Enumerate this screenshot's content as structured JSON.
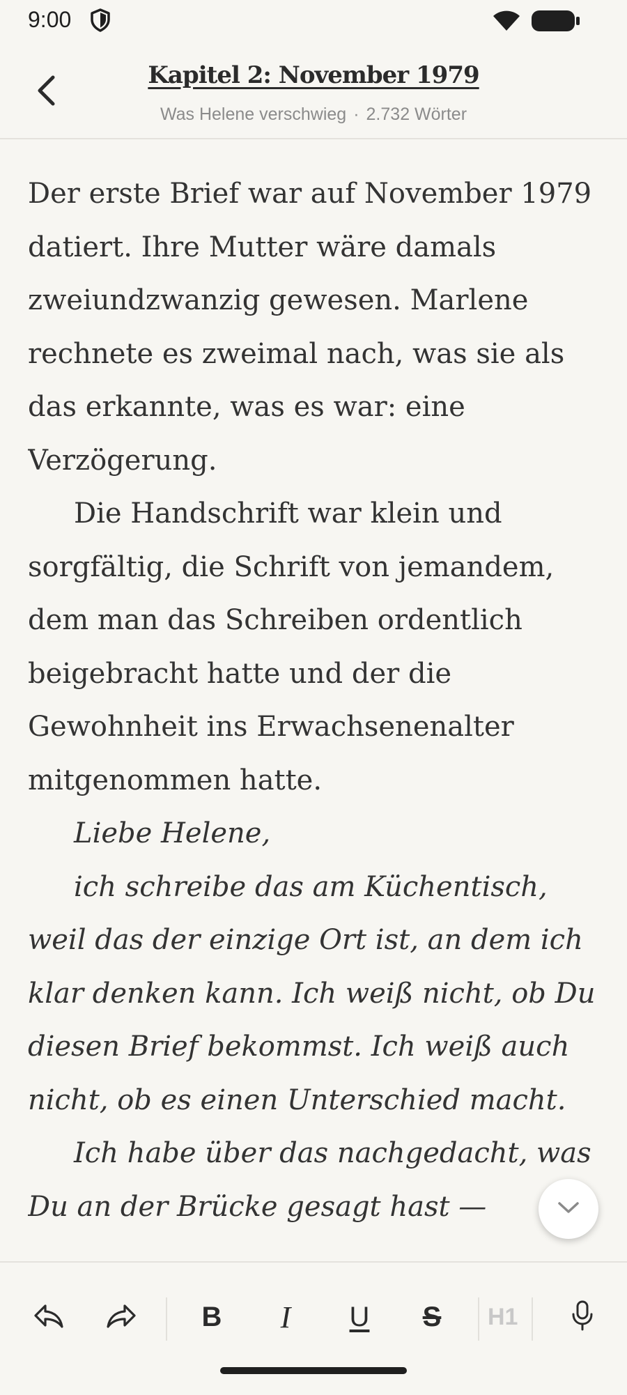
{
  "status_bar": {
    "time": "9:00",
    "icons": [
      "shield-icon",
      "wifi-icon",
      "battery-icon"
    ]
  },
  "header": {
    "chapter_title": "Kapitel 2: November 1979",
    "book_title": "Was Helene verschwieg",
    "separator": "·",
    "word_count": "2.732 Wörter"
  },
  "editor": {
    "paragraphs": [
      {
        "text": "Der erste Brief war auf November 1979 datiert. Ihre Mutter wäre damals zweiundzwanzig gewesen. Marlene rechnete es zweimal nach, was sie als das erkannte, was es war: eine Verzögerung.",
        "indent": false,
        "italic": false
      },
      {
        "text": "Die Handschrift war klein und sorgfältig, die Schrift von jemandem, dem man das Schreiben ordentlich beigebracht hatte und der die Gewohnheit ins Erwachsenenalter mitgenommen hatte.",
        "indent": true,
        "italic": false
      },
      {
        "text": "Liebe Helene,",
        "indent": true,
        "italic": true
      },
      {
        "text": "ich schreibe das am Küchentisch, weil das der einzige Ort ist, an dem ich klar denken kann. Ich weiß nicht, ob Du diesen Brief bekommst. Ich weiß auch nicht, ob es einen Unterschied macht.",
        "indent": true,
        "italic": true
      },
      {
        "text": "Ich habe über das nachgedacht, was Du an der Brücke gesagt hast —",
        "indent": true,
        "italic": true
      }
    ]
  },
  "toolbar": {
    "bold_label": "B",
    "italic_label": "I",
    "underline_label": "U",
    "strike_label": "S",
    "heading_label": "H1"
  },
  "colors": {
    "background": "#f7f6f2",
    "text": "#333333",
    "muted": "#8b8b8b",
    "divider": "#e4e2dd"
  }
}
